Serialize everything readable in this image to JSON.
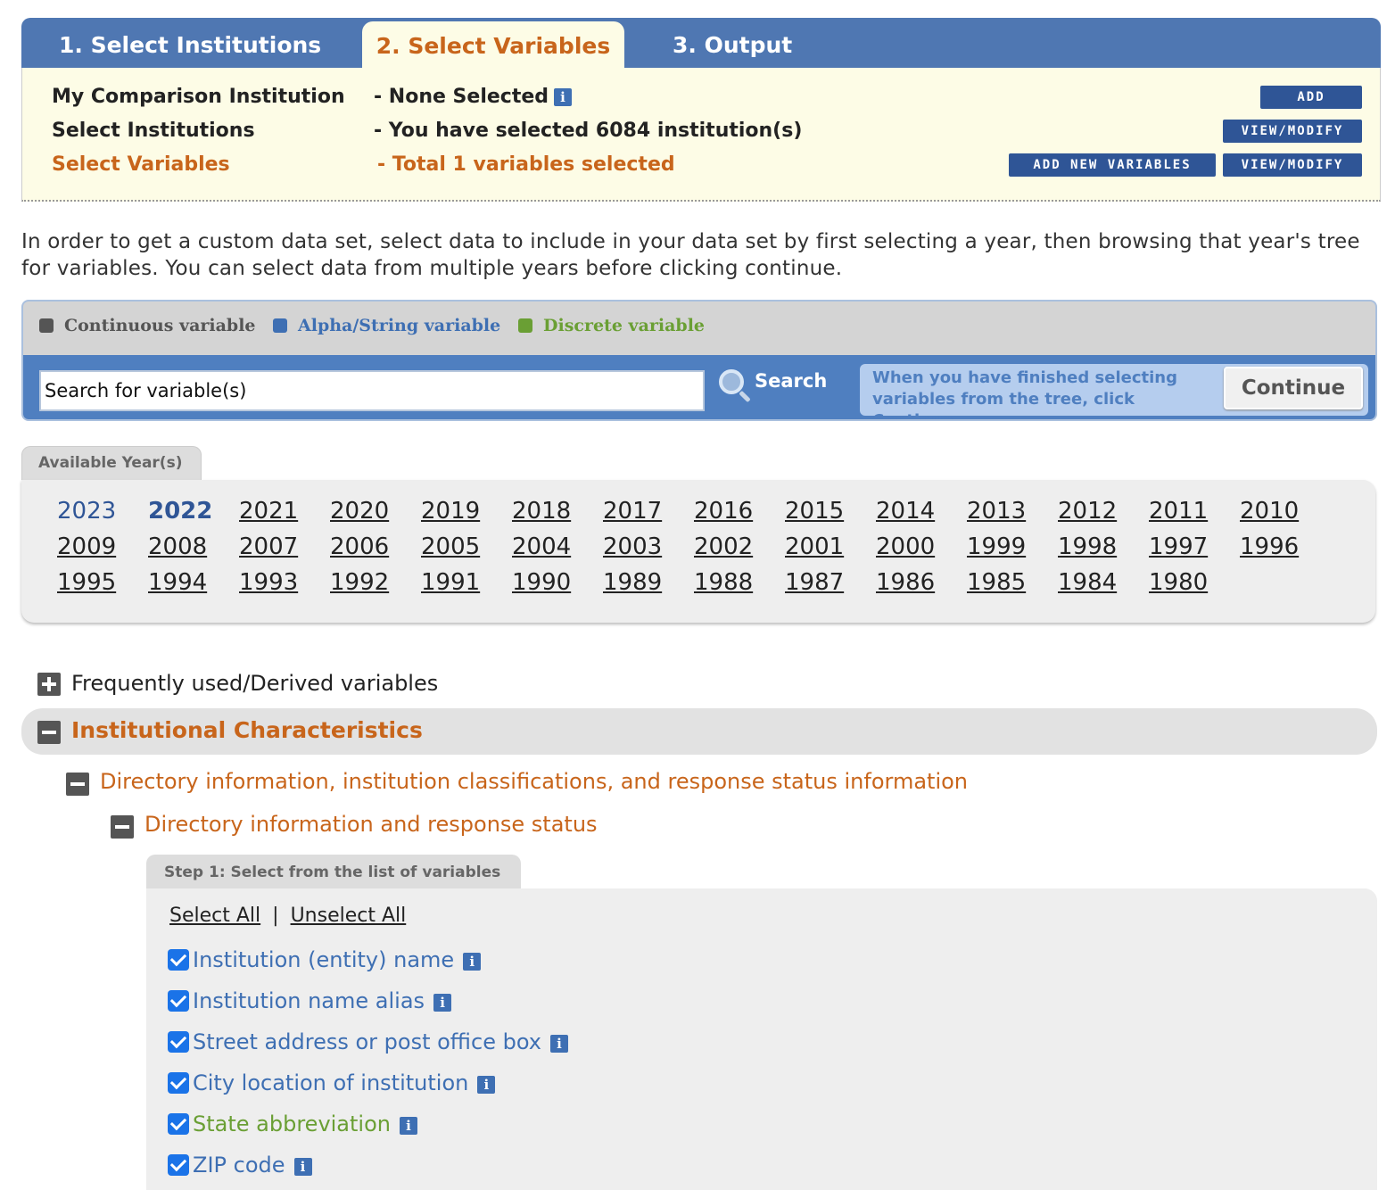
{
  "tabs": [
    "1. Select Institutions",
    "2. Select Variables",
    "3. Output"
  ],
  "summary": {
    "row1": {
      "label": "My Comparison Institution",
      "value": "- None Selected",
      "button": "ADD"
    },
    "row2": {
      "label": "Select Institutions",
      "value": "- You have selected 6084 institution(s)",
      "button": "VIEW/MODIFY"
    },
    "row3": {
      "label": "Select Variables",
      "value": "- Total 1 variables selected",
      "button_add": "ADD NEW VARIABLES",
      "button_view": "VIEW/MODIFY"
    }
  },
  "intro": "In order to get a custom data set, select data to include in your data set by first selecting a year, then browsing that year's tree for variables. You can select data from multiple years before clicking continue.",
  "legend": [
    {
      "label": "Continuous variable",
      "color": "#555555"
    },
    {
      "label": "Alpha/String variable",
      "color": "#3e6fb3"
    },
    {
      "label": "Discrete variable",
      "color": "#6a9f34"
    }
  ],
  "search": {
    "value": "Search for variable(s)",
    "button": "Search"
  },
  "continue": {
    "hint": "When you have finished selecting variables from the tree, click Continue",
    "button": "Continue"
  },
  "years_tab": "Available Year(s)",
  "years": [
    "2023",
    "2022",
    "2021",
    "2020",
    "2019",
    "2018",
    "2017",
    "2016",
    "2015",
    "2014",
    "2013",
    "2012",
    "2011",
    "2010",
    "2009",
    "2008",
    "2007",
    "2006",
    "2005",
    "2004",
    "2003",
    "2002",
    "2001",
    "2000",
    "1999",
    "1998",
    "1997",
    "1996",
    "1995",
    "1994",
    "1993",
    "1992",
    "1991",
    "1990",
    "1989",
    "1988",
    "1987",
    "1986",
    "1985",
    "1984",
    "1980"
  ],
  "tree": {
    "frequent": "Frequently used/Derived variables",
    "ic": "Institutional Characteristics",
    "dir": "Directory information, institution classifications, and response status information",
    "dir_sub": "Directory information and response status"
  },
  "step1": {
    "tab": "Step 1: Select from the list of variables",
    "select_all": "Select All",
    "separator": "|",
    "unselect_all": "Unselect All",
    "variables": [
      {
        "label": "Institution (entity) name",
        "color": "#3e6fb3"
      },
      {
        "label": "Institution name alias",
        "color": "#3e6fb3"
      },
      {
        "label": "Street address or post office box",
        "color": "#3e6fb3"
      },
      {
        "label": "City location of institution",
        "color": "#3e6fb3"
      },
      {
        "label": "State abbreviation",
        "color": "#6a9f34"
      },
      {
        "label": "ZIP code",
        "color": "#3e6fb3"
      }
    ]
  },
  "colors": {
    "accent_orange": "#c8651b",
    "tab_blue": "#4f77b2",
    "link_blue": "#2f5596"
  }
}
